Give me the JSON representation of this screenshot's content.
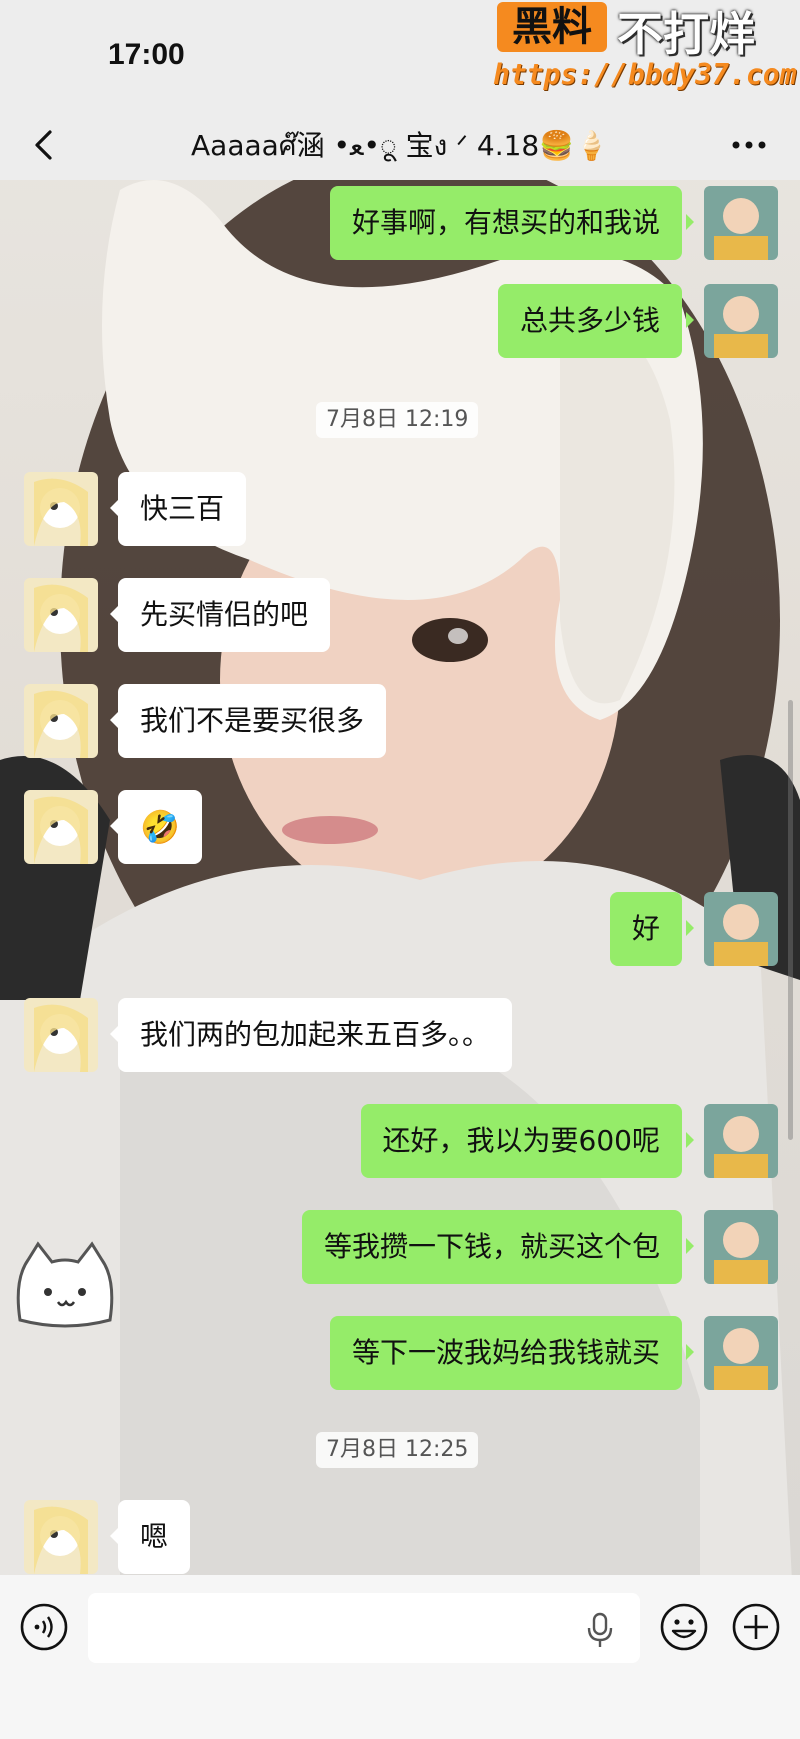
{
  "status_bar": {
    "time": "17:00"
  },
  "watermark": {
    "badge": "黑料",
    "title": "不打烊",
    "url": "https://bbdy37.com"
  },
  "nav": {
    "title": "Aaaaaศ๊涵 •ﻌ•ू 宝ง ᐟ 4.18🍔🍦"
  },
  "messages": [
    {
      "side": "self",
      "text": "好事啊，有想买的和我说"
    },
    {
      "side": "self",
      "text": "总共多少钱"
    },
    {
      "side": "other",
      "text": "快三百"
    },
    {
      "side": "other",
      "text": "先买情侣的吧"
    },
    {
      "side": "other",
      "text": "我们不是要买很多"
    },
    {
      "side": "other",
      "text": "🤣"
    },
    {
      "side": "self",
      "text": "好"
    },
    {
      "side": "other",
      "text": "我们两的包加起来五百多。。"
    },
    {
      "side": "self",
      "text": "还好，我以为要600呢"
    },
    {
      "side": "self",
      "text": "等我攒一下钱，就买这个包"
    },
    {
      "side": "self",
      "text": "等下一波我妈给我钱就买"
    },
    {
      "side": "other",
      "text": "嗯"
    }
  ],
  "timestamps": [
    "7月8日 12:19",
    "7月8日 12:25"
  ],
  "icons": {
    "back": "chevron-left-icon",
    "more": "more-dots-icon",
    "voice": "voice-icon",
    "mic": "microphone-icon",
    "emoji": "emoji-icon",
    "plus": "plus-icon",
    "sticker": "cat-sticker"
  },
  "colors": {
    "self_bubble": "#95ec69",
    "other_bubble": "#ffffff",
    "bar_bg": "#ededed",
    "watermark_accent": "#f58a1f"
  }
}
